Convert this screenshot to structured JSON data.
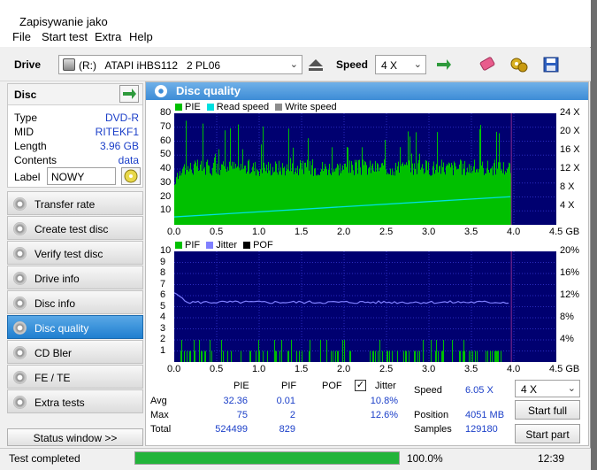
{
  "window": {
    "title": "Zapisywanie jako"
  },
  "menu": [
    "File",
    "Start test",
    "Extra",
    "Help"
  ],
  "drivebar": {
    "drive_label": "Drive",
    "drive_value": "(R:)   ATAPI iHBS112   2 PL06",
    "speed_label": "Speed",
    "speed_value": "4 X"
  },
  "disc": {
    "header": "Disc",
    "type_label": "Type",
    "type_value": "DVD-R",
    "mid_label": "MID",
    "mid_value": "RITEKF1",
    "length_label": "Length",
    "length_value": "3.96 GB",
    "contents_label": "Contents",
    "contents_value": "data",
    "label_label": "Label",
    "label_value": "NOWY"
  },
  "nav": [
    {
      "label": "Transfer rate",
      "active": false
    },
    {
      "label": "Create test disc",
      "active": false
    },
    {
      "label": "Verify test disc",
      "active": false
    },
    {
      "label": "Drive info",
      "active": false
    },
    {
      "label": "Disc info",
      "active": false
    },
    {
      "label": "Disc quality",
      "active": true
    },
    {
      "label": "CD Bler",
      "active": false
    },
    {
      "label": "FE / TE",
      "active": false
    },
    {
      "label": "Extra tests",
      "active": false
    }
  ],
  "status_window_button": "Status window >>",
  "panel_title": "Disc quality",
  "chart_data": [
    {
      "type": "bar",
      "legend": [
        "PIE",
        "Read speed",
        "Write speed"
      ],
      "colors": {
        "PIE": "#00c000",
        "Read speed": "#00e0e0",
        "Write speed": "#8c8c8c"
      },
      "x_ticks": [
        "0.0",
        "0.5",
        "1.0",
        "1.5",
        "2.0",
        "2.5",
        "3.0",
        "3.5",
        "4.0",
        "4.5 GB"
      ],
      "xlim": [
        0,
        4.5
      ],
      "data_end": 3.96,
      "y_ticks_left": [
        "10",
        "20",
        "30",
        "40",
        "50",
        "60",
        "70",
        "80"
      ],
      "ylim_left": [
        0,
        80
      ],
      "y_ticks_right": [
        "4 X",
        "8 X",
        "12 X",
        "16 X",
        "20 X",
        "24 X"
      ],
      "ylim_right": [
        0,
        24
      ],
      "pie_typical": 40,
      "pie_max": 75,
      "read_speed": {
        "x": [
          0,
          3.96
        ],
        "y": [
          1.7,
          6.05
        ]
      }
    },
    {
      "type": "bar",
      "legend": [
        "PIF",
        "Jitter",
        "POF"
      ],
      "colors": {
        "PIF": "#00c000",
        "Jitter": "#8080ff",
        "POF": "#000000"
      },
      "x_ticks": [
        "0.0",
        "0.5",
        "1.0",
        "1.5",
        "2.0",
        "2.5",
        "3.0",
        "3.5",
        "4.0",
        "4.5 GB"
      ],
      "xlim": [
        0,
        4.5
      ],
      "data_end": 3.96,
      "y_ticks_left": [
        "1",
        "2",
        "3",
        "4",
        "5",
        "6",
        "7",
        "8",
        "9",
        "10"
      ],
      "ylim_left": [
        0,
        10
      ],
      "y_ticks_right": [
        "4%",
        "8%",
        "12%",
        "16%",
        "20%"
      ],
      "ylim_right": [
        0,
        20
      ],
      "jitter_avg": 10.8,
      "pif_max": 2
    }
  ],
  "stats": {
    "col_pie": "PIE",
    "col_pif": "PIF",
    "col_pof": "POF",
    "col_jitter": "Jitter",
    "row_avg": "Avg",
    "row_max": "Max",
    "row_total": "Total",
    "avg": {
      "pie": "32.36",
      "pif": "0.01",
      "jitter": "10.8%"
    },
    "max": {
      "pie": "75",
      "pif": "2",
      "jitter": "12.6%"
    },
    "total": {
      "pie": "524499",
      "pif": "829"
    },
    "speed_label": "Speed",
    "speed_value": "6.05 X",
    "position_label": "Position",
    "position_value": "4051 MB",
    "samples_label": "Samples",
    "samples_value": "129180",
    "speed_select": "4 X",
    "start_full": "Start full",
    "start_part": "Start part"
  },
  "statusbar": {
    "text": "Test completed",
    "progress": 100,
    "progress_text": "100.0%",
    "time": "12:39"
  }
}
